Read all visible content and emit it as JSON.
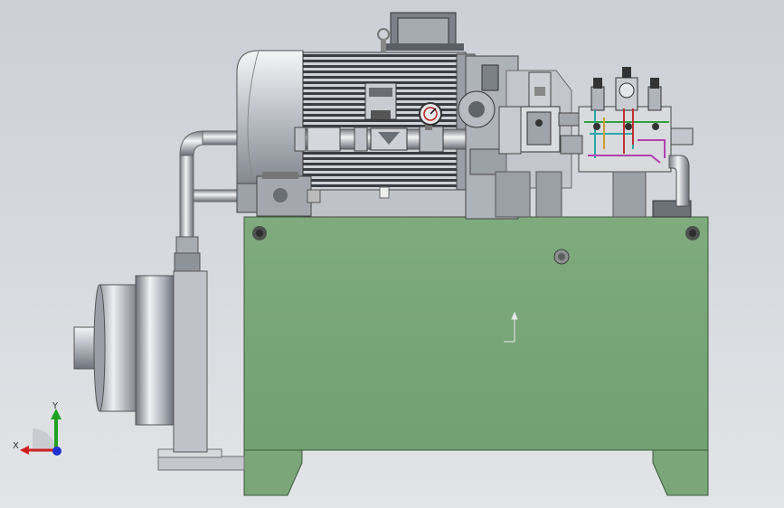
{
  "viewport": {
    "background_top": "#ccd0d6",
    "background_bottom": "#e2e4e7"
  },
  "colors": {
    "tank_green": "#7aa67a",
    "tank_edge": "#3c5a3c",
    "metal_light": "#eef0f3",
    "metal_mid": "#b4b8bf",
    "metal_dark": "#6d7178",
    "motor_fin": "#3a3d44",
    "pipe_cyan": "#2aa7a7",
    "pipe_magenta": "#b040b0",
    "pipe_red": "#c03030",
    "pipe_green": "#30a040",
    "axis_x": "#d02020",
    "axis_y": "#20a020",
    "axis_z": "#2030d0"
  },
  "components": {
    "tank": "hydraulic-oil-tank",
    "motor": "electric-motor",
    "terminal_box": "motor-terminal-box",
    "gauge": "pressure-gauge",
    "valve_block": "manifold-valve-block",
    "cooler": "oil-cooler-housing",
    "pipe": "suction-pipe"
  },
  "triad": {
    "x_label": "X",
    "y_label": "Y"
  }
}
